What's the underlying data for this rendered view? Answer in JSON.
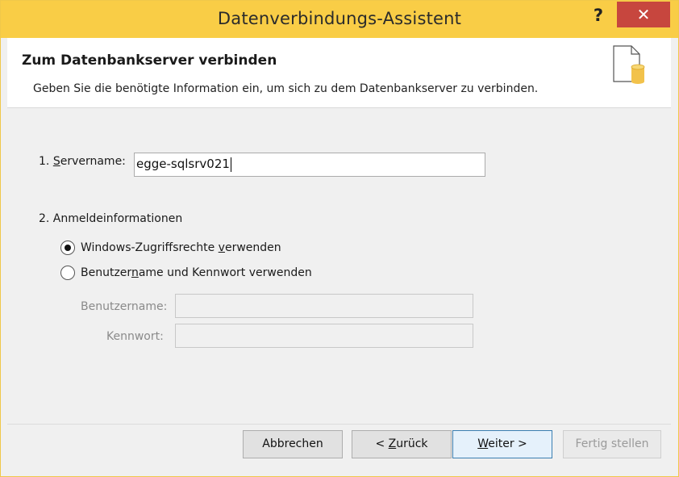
{
  "window": {
    "title": "Datenverbindungs-Assistent",
    "help_label": "?",
    "close_label": "✕"
  },
  "header": {
    "title": "Zum Datenbankserver verbinden",
    "subtitle": "Geben Sie die benötigte Information ein, um sich zu dem Datenbankserver zu verbinden."
  },
  "server": {
    "label_prefix": "1. ",
    "label_accel": "S",
    "label_rest": "ervername:",
    "value": "egge-sqlsrv021"
  },
  "login": {
    "section_label": "2. Anmeldeinformationen",
    "option_windows": {
      "before": "Windows-Zugriffsrechte ",
      "accel": "v",
      "after": "erwenden",
      "checked": true
    },
    "option_userpass": {
      "before": "Benutzer",
      "accel": "n",
      "after": "ame und Kennwort verwenden",
      "checked": false
    },
    "username_label": "Benutzername:",
    "username_value": "",
    "password_label": "Kennwort:",
    "password_value": ""
  },
  "buttons": {
    "cancel": "Abbrechen",
    "back_before": "< ",
    "back_accel": "Z",
    "back_after": "urück",
    "next_accel": "W",
    "next_after": "eiter >",
    "finish": "Fertig stellen"
  },
  "colors": {
    "titlebar": "#f9cd46",
    "close": "#c7463e"
  }
}
